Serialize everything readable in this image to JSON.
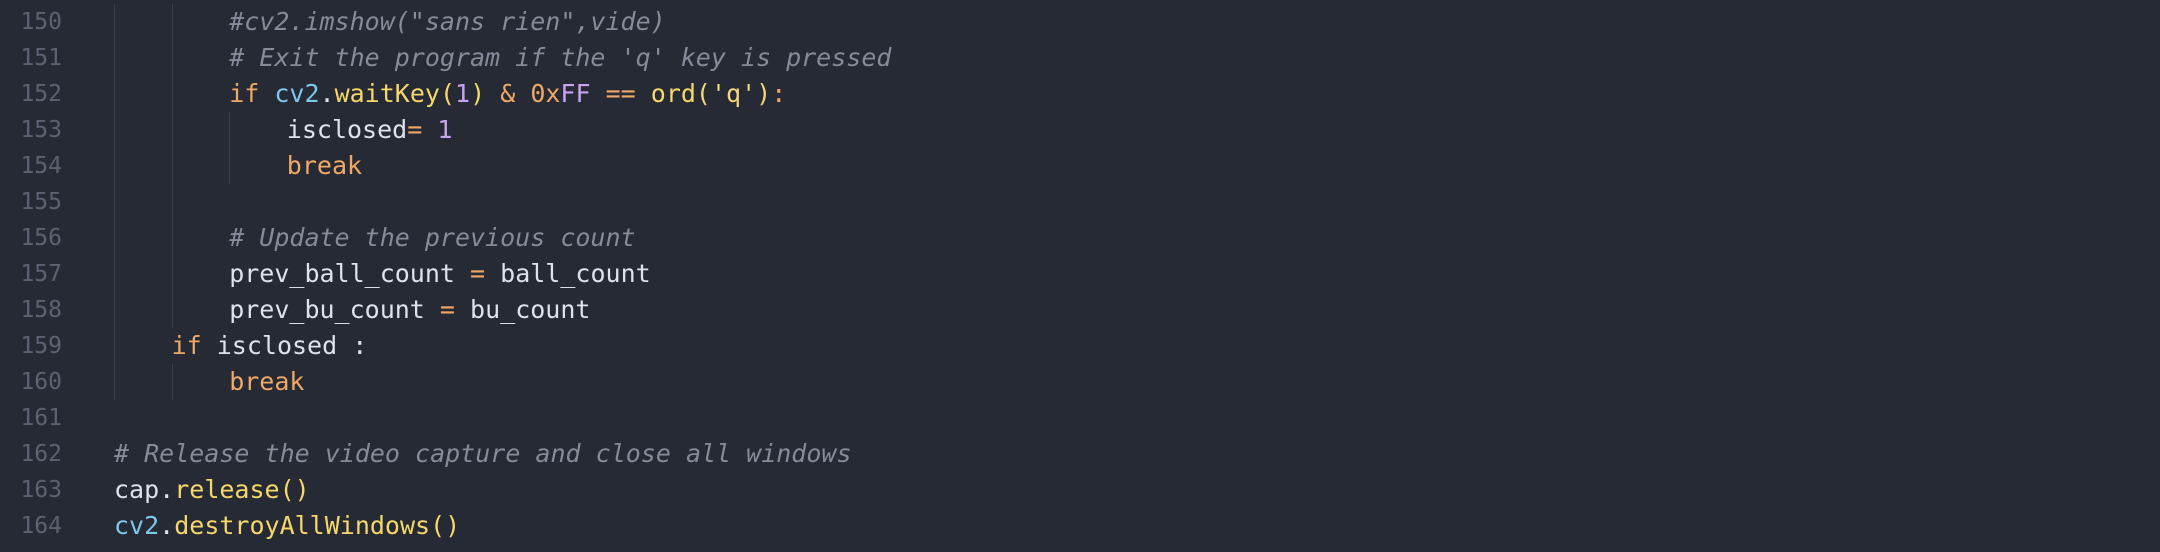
{
  "editor": {
    "theme": {
      "background": "#262a35",
      "line_number": "#5d6272",
      "comment": "#858b99",
      "keyword": "#f0a866",
      "module": "#7ec6ec",
      "function": "#f6d86a",
      "number": "#c9a2f0",
      "text": "#dfe2e8"
    },
    "lines": [
      {
        "number": "150",
        "indent": 2,
        "tokens": [
          {
            "text": "#cv2.imshow(\"sans rien\",vide)",
            "type": "comment"
          }
        ]
      },
      {
        "number": "151",
        "indent": 2,
        "tokens": [
          {
            "text": "# Exit the program if the 'q' key is pressed",
            "type": "comment"
          }
        ]
      },
      {
        "number": "152",
        "indent": 2,
        "tokens": [
          {
            "text": "if",
            "type": "keyword"
          },
          {
            "text": " ",
            "type": "default"
          },
          {
            "text": "cv2",
            "type": "module"
          },
          {
            "text": ".",
            "type": "default"
          },
          {
            "text": "waitKey",
            "type": "func"
          },
          {
            "text": "(",
            "type": "func"
          },
          {
            "text": "1",
            "type": "number"
          },
          {
            "text": ")",
            "type": "func"
          },
          {
            "text": " ",
            "type": "default"
          },
          {
            "text": "&",
            "type": "op"
          },
          {
            "text": " ",
            "type": "default"
          },
          {
            "text": "0x",
            "type": "op"
          },
          {
            "text": "FF",
            "type": "number"
          },
          {
            "text": " ",
            "type": "default"
          },
          {
            "text": "==",
            "type": "op"
          },
          {
            "text": " ",
            "type": "default"
          },
          {
            "text": "ord",
            "type": "func"
          },
          {
            "text": "('q')",
            "type": "string"
          },
          {
            "text": ":",
            "type": "op"
          }
        ]
      },
      {
        "number": "153",
        "indent": 3,
        "tokens": [
          {
            "text": "isclosed",
            "type": "default"
          },
          {
            "text": "=",
            "type": "op"
          },
          {
            "text": " ",
            "type": "default"
          },
          {
            "text": "1",
            "type": "number"
          }
        ]
      },
      {
        "number": "154",
        "indent": 3,
        "tokens": [
          {
            "text": "break",
            "type": "keyword"
          }
        ]
      },
      {
        "number": "155",
        "indent": 0,
        "tokens": []
      },
      {
        "number": "156",
        "indent": 2,
        "tokens": [
          {
            "text": "# Update the previous count",
            "type": "comment"
          }
        ]
      },
      {
        "number": "157",
        "indent": 2,
        "tokens": [
          {
            "text": "prev_ball_count",
            "type": "default"
          },
          {
            "text": " ",
            "type": "default"
          },
          {
            "text": "=",
            "type": "op"
          },
          {
            "text": " ",
            "type": "default"
          },
          {
            "text": "ball_count",
            "type": "default"
          }
        ]
      },
      {
        "number": "158",
        "indent": 2,
        "tokens": [
          {
            "text": "prev_bu_count",
            "type": "default"
          },
          {
            "text": " ",
            "type": "default"
          },
          {
            "text": "=",
            "type": "op"
          },
          {
            "text": " ",
            "type": "default"
          },
          {
            "text": "bu_count",
            "type": "default"
          }
        ]
      },
      {
        "number": "159",
        "indent": 1,
        "tokens": [
          {
            "text": "if",
            "type": "keyword"
          },
          {
            "text": " isclosed :",
            "type": "default"
          }
        ]
      },
      {
        "number": "160",
        "indent": 2,
        "tokens": [
          {
            "text": "break",
            "type": "keyword"
          }
        ]
      },
      {
        "number": "161",
        "indent": 0,
        "tokens": []
      },
      {
        "number": "162",
        "indent": 0,
        "tokens": [
          {
            "text": "# Release the video capture and close all windows",
            "type": "comment"
          }
        ]
      },
      {
        "number": "163",
        "indent": 0,
        "tokens": [
          {
            "text": "cap",
            "type": "default"
          },
          {
            "text": ".",
            "type": "default"
          },
          {
            "text": "release",
            "type": "func"
          },
          {
            "text": "()",
            "type": "func"
          }
        ]
      },
      {
        "number": "164",
        "indent": 0,
        "tokens": [
          {
            "text": "cv2",
            "type": "module"
          },
          {
            "text": ".",
            "type": "default"
          },
          {
            "text": "destroyAllWindows",
            "type": "func"
          },
          {
            "text": "()",
            "type": "func"
          }
        ]
      }
    ]
  }
}
